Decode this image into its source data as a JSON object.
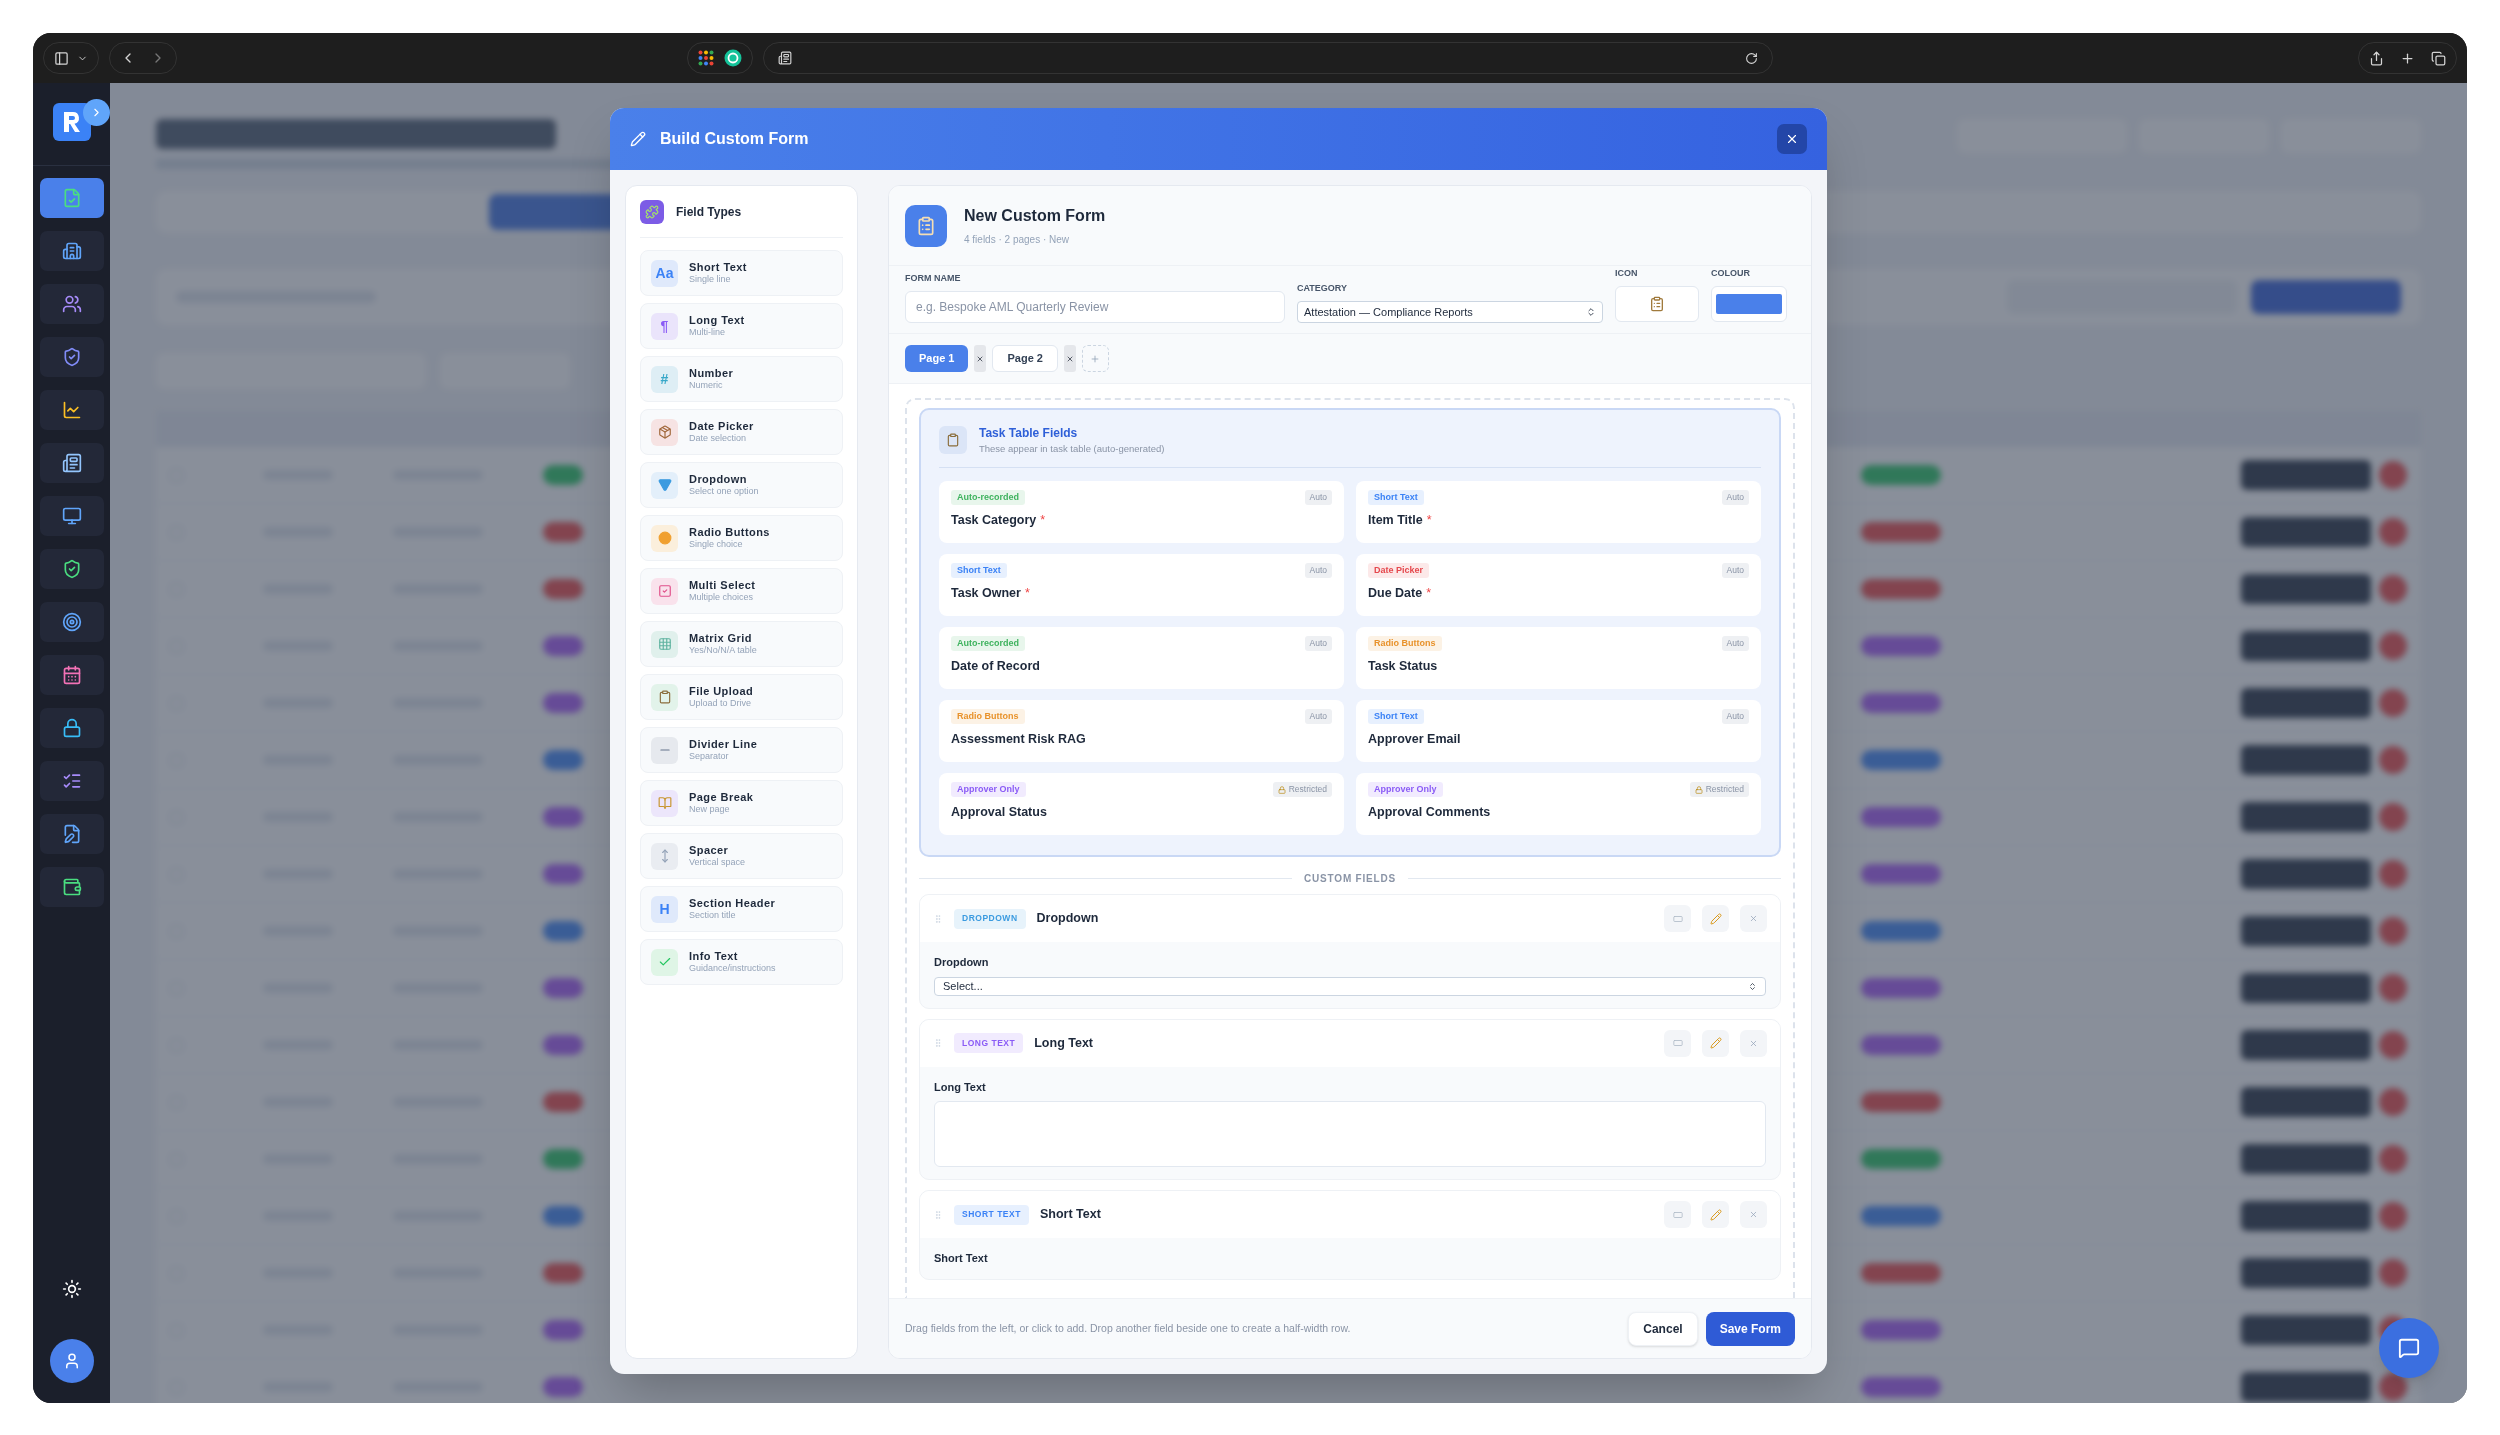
{
  "sidebar": [
    {
      "selected": true
    },
    {
      "selected": false
    },
    {
      "selected": false
    },
    {
      "selected": false
    },
    {
      "selected": false
    },
    {
      "selected": false
    },
    {
      "selected": false
    },
    {
      "selected": false
    },
    {
      "selected": false
    },
    {
      "selected": false
    },
    {
      "selected": false
    },
    {
      "selected": false
    },
    {
      "selected": false
    },
    {
      "selected": false
    }
  ],
  "modal": {
    "title": "Build Custom Form",
    "field_types": {
      "title": "Field Types",
      "items": [
        {
          "kind": "glyph",
          "glyph": "Aa",
          "color": "#3b82f6",
          "label": "Short Text",
          "hint": "Single line"
        },
        {
          "kind": "glyph",
          "glyph": "¶",
          "color": "#8b5cf6",
          "label": "Long Text",
          "hint": "Multi-line"
        },
        {
          "kind": "glyph",
          "glyph": "#",
          "color": "#38a8c9",
          "label": "Number",
          "hint": "Numeric"
        },
        {
          "kind": "package",
          "label": "Date Picker",
          "hint": "Date selection"
        },
        {
          "kind": "triangle",
          "label": "Dropdown",
          "hint": "Select one option"
        },
        {
          "kind": "radio",
          "label": "Radio Buttons",
          "hint": "Single choice"
        },
        {
          "kind": "checkbox",
          "label": "Multi Select",
          "hint": "Multiple choices"
        },
        {
          "kind": "grid",
          "label": "Matrix Grid",
          "hint": "Yes/No/N/A table"
        },
        {
          "kind": "clipboard",
          "label": "File Upload",
          "hint": "Upload to Drive"
        },
        {
          "kind": "line",
          "label": "Divider Line",
          "hint": "Separator"
        },
        {
          "kind": "book",
          "label": "Page Break",
          "hint": "New page"
        },
        {
          "kind": "updown",
          "label": "Spacer",
          "hint": "Vertical space"
        },
        {
          "kind": "glyph",
          "glyph": "H",
          "color": "#3b82f6",
          "label": "Section Header",
          "hint": "Section title"
        },
        {
          "kind": "check",
          "label": "Info Text",
          "hint": "Guidance/instructions"
        }
      ]
    },
    "form": {
      "title": "New Custom Form",
      "meta": "4 fields · 2 pages · New",
      "name_field": {
        "label": "FORM NAME",
        "placeholder": "e.g. Bespoke AML Quarterly Review"
      },
      "category": {
        "label": "CATEGORY",
        "value": "Attestation — Compliance Reports"
      },
      "icon_field": {
        "label": "ICON"
      },
      "colour_field": {
        "label": "COLOUR",
        "color": "#4a80ea"
      },
      "pages": [
        {
          "label": "Page 1",
          "selected": true
        },
        {
          "label": "Page 2",
          "selected": false
        }
      ],
      "task_table": {
        "title": "Task Table Fields",
        "subtitle": "These appear in task table (auto-generated)",
        "required_mark": "*",
        "fields": [
          {
            "tag": "Auto-recorded",
            "color": "#3fb35f",
            "name": "Task Category",
            "required": true,
            "badge": "Auto",
            "locked": false
          },
          {
            "tag": "Short Text",
            "color": "#3b82f6",
            "name": "Item Title",
            "required": true,
            "badge": "Auto",
            "locked": false
          },
          {
            "tag": "Short Text",
            "color": "#3b82f6",
            "name": "Task Owner",
            "required": true,
            "badge": "Auto",
            "locked": false
          },
          {
            "tag": "Date Picker",
            "color": "#e5484d",
            "name": "Due Date",
            "required": true,
            "badge": "Auto",
            "locked": false
          },
          {
            "tag": "Auto-recorded",
            "color": "#3fb35f",
            "name": "Date of Record",
            "required": false,
            "badge": "Auto",
            "locked": false
          },
          {
            "tag": "Radio Buttons",
            "color": "#e8922b",
            "name": "Task Status",
            "required": false,
            "badge": "Auto",
            "locked": false
          },
          {
            "tag": "Radio Buttons",
            "color": "#e8922b",
            "name": "Assessment Risk RAG",
            "required": false,
            "badge": "Auto",
            "locked": false
          },
          {
            "tag": "Short Text",
            "color": "#3b82f6",
            "name": "Approver Email",
            "required": false,
            "badge": "Auto",
            "locked": false
          },
          {
            "tag": "Approver Only",
            "color": "#8b5cf6",
            "name": "Approval Status",
            "required": false,
            "badge": "Restricted",
            "locked": true
          },
          {
            "tag": "Approver Only",
            "color": "#8b5cf6",
            "name": "Approval Comments",
            "required": false,
            "badge": "Restricted",
            "locked": true
          }
        ]
      },
      "custom_label": "CUSTOM FIELDS",
      "custom_fields": [
        {
          "kind": "dropdown",
          "tag": "DROPDOWN",
          "color": "#3b9be0",
          "title": "Dropdown",
          "label": "Dropdown",
          "value": "Select..."
        },
        {
          "kind": "textarea",
          "tag": "LONG TEXT",
          "color": "#8b5cf6",
          "title": "Long Text",
          "label": "Long Text"
        },
        {
          "kind": "text",
          "tag": "SHORT TEXT",
          "color": "#3b82f6",
          "title": "Short Text",
          "label": "Short Text"
        }
      ],
      "footer_hint": "Drag fields from the left, or click to add. Drop another field beside one to create a half-width row.",
      "buttons": [
        {
          "label": "Cancel",
          "kind": "secondary"
        },
        {
          "label": "Save Form",
          "kind": "primary"
        }
      ]
    }
  }
}
